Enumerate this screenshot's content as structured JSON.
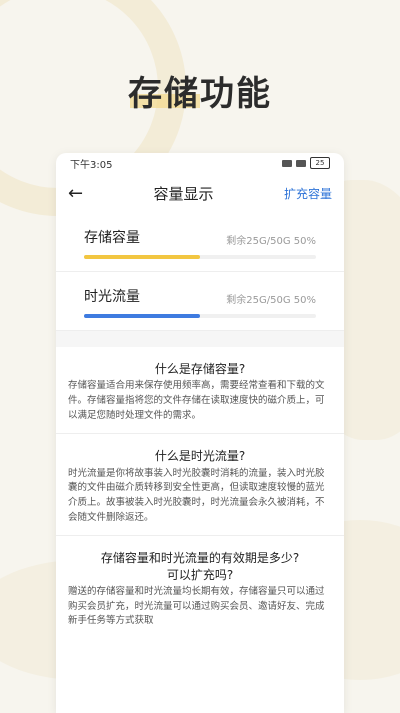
{
  "hero": {
    "title": "存储功能"
  },
  "status_bar": {
    "time": "下午3:05",
    "battery": "25"
  },
  "navbar": {
    "title": "容量显示",
    "action": "扩充容量"
  },
  "cards": [
    {
      "label": "存储容量",
      "meta": "剩余25G/50G  50%",
      "progress": 0.5,
      "color": "#f2c641"
    },
    {
      "label": "时光流量",
      "meta": "剩余25G/50G  50%",
      "progress": 0.5,
      "color": "#3e7be0"
    }
  ],
  "faqs": [
    {
      "q": "什么是存储容量?",
      "a": "存储容量适合用来保存使用频率高，需要经常查看和下载的文件。存储容量指将您的文件存储在读取速度快的磁介质上，可以满足您随时处理文件的需求。"
    },
    {
      "q": "什么是时光流量?",
      "a": "时光流量是你将故事装入时光胶囊时消耗的流量，装入时光胶囊的文件由磁介质转移到安全性更高，但读取速度较慢的蓝光介质上。故事被装入时光胶囊时，时光流量会永久被消耗，不会随文件删除返还。"
    },
    {
      "q": "存储容量和时光流量的有效期是多少?\n可以扩充吗?",
      "a": "赠送的存储容量和时光流量均长期有效，存储容量只可以通过购买会员扩充，时光流量可以通过购买会员、邀请好友、完成新手任务等方式获取"
    }
  ]
}
